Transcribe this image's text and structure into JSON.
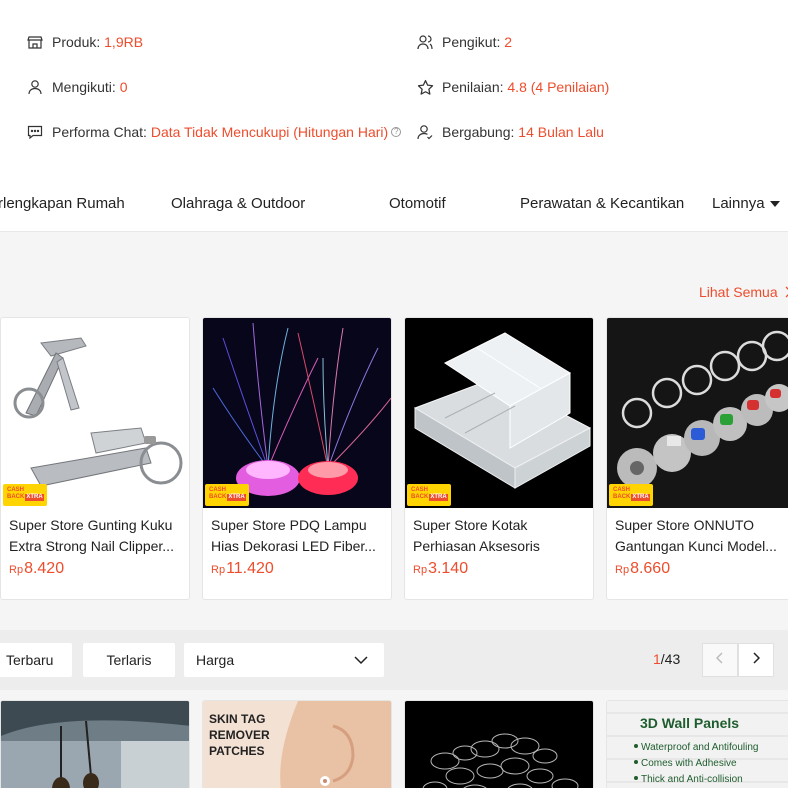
{
  "stats": {
    "products": {
      "label": "Produk:",
      "value": "1,9RB",
      "icon": "store-icon"
    },
    "followers": {
      "label": "Pengikut:",
      "value": "2",
      "icon": "followers-icon"
    },
    "following": {
      "label": "Mengikuti:",
      "value": "0",
      "icon": "user-icon"
    },
    "rating": {
      "label": "Penilaian:",
      "value": "4.8 (4 Penilaian)",
      "icon": "star-icon"
    },
    "chat": {
      "label": "Performa Chat:",
      "value": "Data Tidak Mencukupi (Hitungan Hari)",
      "icon": "chat-icon",
      "help": "?"
    },
    "joined": {
      "label": "Bergabung:",
      "value": "14 Bulan Lalu",
      "icon": "user-check-icon"
    }
  },
  "categories": [
    "rlengkapan Rumah",
    "Olahraga & Outdoor",
    "Otomotif",
    "Perawatan & Kecantikan",
    "Lainnya"
  ],
  "featured": {
    "see_all": "Lihat Semua",
    "badge": {
      "top": "CASH",
      "mid": "BACK",
      "tag": "XTRA"
    },
    "currency": "Rp",
    "products": [
      {
        "name": "Super Store Gunting Kuku Extra Strong Nail Clipper...",
        "price": "8.420"
      },
      {
        "name": "Super Store PDQ Lampu Hias Dekorasi LED Fiber...",
        "price": "11.420"
      },
      {
        "name": "Super Store Kotak Perhiasan Aksesoris Plast...",
        "price": "3.140"
      },
      {
        "name": "Super Store ONNUTO Gantungan Kunci Model...",
        "price": "8.660"
      }
    ]
  },
  "sort": {
    "newest": "Terbaru",
    "bestseller": "Terlaris",
    "price": "Harga",
    "page_current": "1",
    "page_total": "/43"
  },
  "grid": {
    "skin_tag": {
      "line1": "SKIN TAG",
      "line2": "REMOVER",
      "line3": "PATCHES"
    },
    "wall_panels": {
      "title": "3D Wall Panels",
      "bullets": [
        "Waterproof and Antifouling",
        "Comes with Adhesive",
        "Thick and Anti-collision"
      ]
    }
  },
  "colors": {
    "accent": "#ee4d2d",
    "badge_yellow": "#ffd400"
  }
}
